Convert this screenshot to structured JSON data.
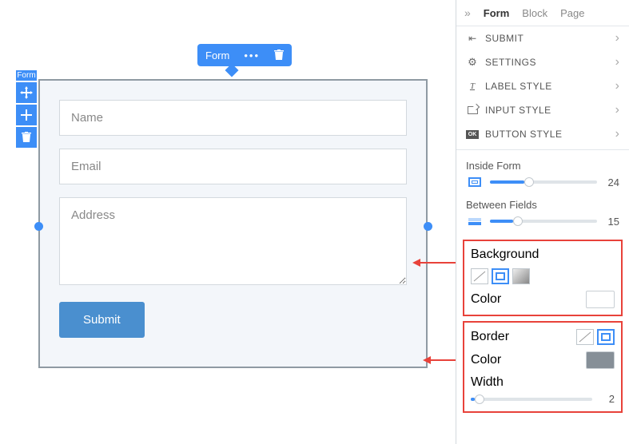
{
  "pill": {
    "label": "Form"
  },
  "sideTab": "Form",
  "form": {
    "fields": [
      {
        "placeholder": "Name"
      },
      {
        "placeholder": "Email"
      },
      {
        "placeholder": "Address"
      }
    ],
    "submit": "Submit"
  },
  "panel": {
    "tabs": [
      "Form",
      "Block",
      "Page"
    ],
    "activeTab": "Form",
    "menu": [
      {
        "label": "SUBMIT"
      },
      {
        "label": "SETTINGS"
      },
      {
        "label": "LABEL STYLE"
      },
      {
        "label": "INPUT STYLE"
      },
      {
        "label": "BUTTON STYLE"
      }
    ],
    "insideForm": {
      "label": "Inside Form",
      "value": 24,
      "pct": 32
    },
    "betweenFields": {
      "label": "Between Fields",
      "value": 15,
      "pct": 22
    },
    "background": {
      "title": "Background",
      "colorLabel": "Color"
    },
    "border": {
      "title": "Border",
      "colorLabel": "Color",
      "widthLabel": "Width",
      "width": 2,
      "pct": 3,
      "color": "#868f97"
    }
  }
}
